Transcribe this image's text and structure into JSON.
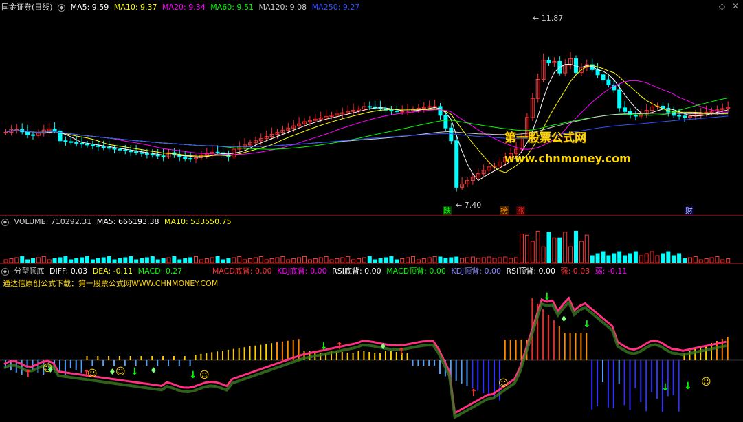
{
  "top_header": {
    "title": "国金证券(日线)",
    "items": [
      {
        "text": "MA5: 9.59",
        "color": "#ffffff"
      },
      {
        "text": "MA10: 9.37",
        "color": "#ffff00"
      },
      {
        "text": "MA20: 9.34",
        "color": "#ff00ff"
      },
      {
        "text": "MA60: 9.51",
        "color": "#00ff00"
      },
      {
        "text": "MA120: 9.08",
        "color": "#cccccc"
      },
      {
        "text": "MA250: 9.27",
        "color": "#3050ff"
      }
    ]
  },
  "corner_icons": [
    "diamond-icon",
    "close-icon"
  ],
  "price_annotations": {
    "high": "11.87",
    "low": "7.40"
  },
  "event_tags": [
    {
      "text": "跌",
      "color": "#00ff00"
    },
    {
      "text": "榜",
      "color": "#ff9900"
    },
    {
      "text": "涨",
      "color": "#ff3030"
    },
    {
      "text": "财",
      "color": "#ccccff"
    }
  ],
  "watermark": {
    "line1": "第一股票公式网",
    "line2": "www.chnmoney.com"
  },
  "volume_header": {
    "items": [
      {
        "text": "VOLUME: 710292.31",
        "color": "#cccccc"
      },
      {
        "text": "MA5: 666193.38",
        "color": "#ffffff"
      },
      {
        "text": "MA10: 533550.75",
        "color": "#ffff00"
      }
    ]
  },
  "indicator_header": {
    "items": [
      {
        "text": "分型顶底",
        "color": "#cccccc"
      },
      {
        "text": "DIFF: 0.03",
        "color": "#ffffff"
      },
      {
        "text": "DEA: -0.11",
        "color": "#ffff00"
      },
      {
        "text": "MACD: 0.27",
        "color": "#00ff00"
      },
      {
        "text": "MACD底背: 0.00",
        "color": "#ff3030"
      },
      {
        "text": "KDJ底背: 0.00",
        "color": "#ff00ff"
      },
      {
        "text": "RSI底背: 0.00",
        "color": "#ffffff"
      },
      {
        "text": "MACD顶背: 0.00",
        "color": "#00ff00"
      },
      {
        "text": "KDJ顶背: 0.00",
        "color": "#8888ff"
      },
      {
        "text": "RSI顶背: 0.00",
        "color": "#ffffff"
      },
      {
        "text": "强: 0.03",
        "color": "#ff3030"
      },
      {
        "text": "弱: -0.11",
        "color": "#ff00ff"
      }
    ]
  },
  "source_text": "通达信原创公式下载：第一股票公式网WWW.CHNMONEY.COM",
  "chart_data": {
    "type": "candlestick",
    "price_range": [
      7.4,
      11.87
    ],
    "ma_colors": {
      "MA5": "#ffffff",
      "MA10": "#ffff00",
      "MA20": "#ff00ff",
      "MA60": "#00ff00",
      "MA120": "#cccccc",
      "MA250": "#3050ff"
    },
    "up_color": "#ff3030",
    "down_color": "#00ffff"
  }
}
